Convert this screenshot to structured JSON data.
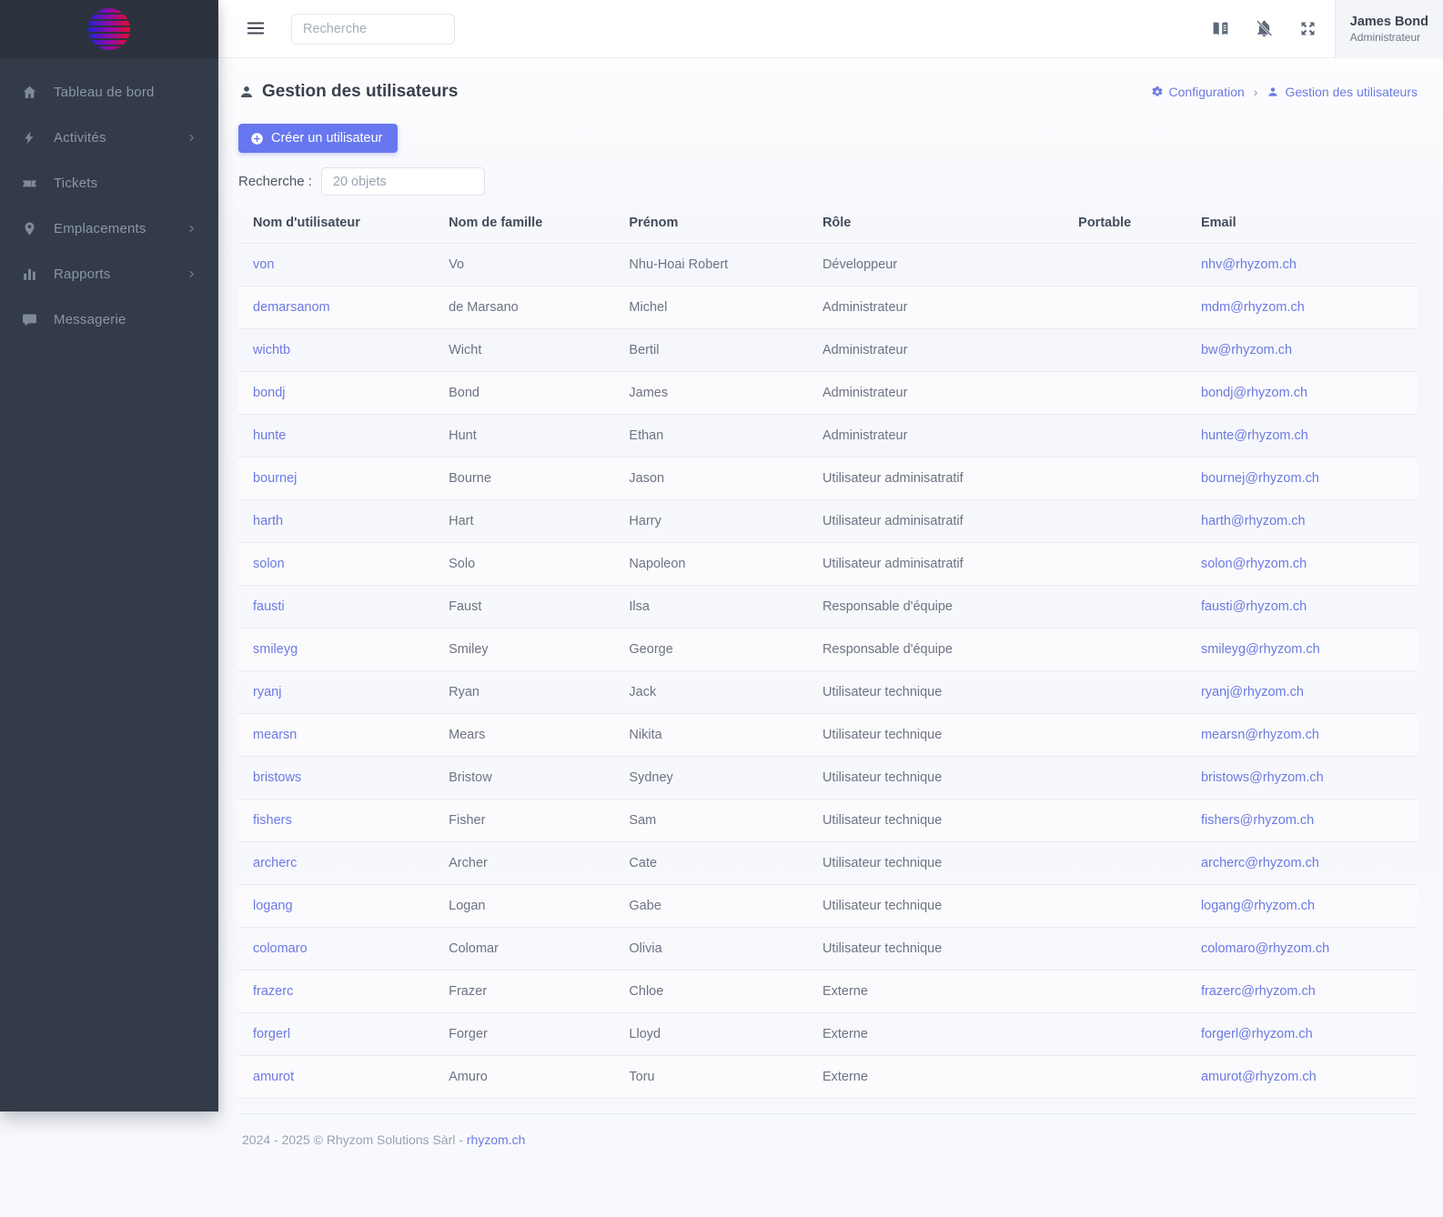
{
  "colors": {
    "accent": "#6777ef",
    "link": "#6c7ae0",
    "sidebar_bg": "#333b48"
  },
  "sidebar": {
    "items": [
      {
        "id": "dashboard",
        "icon": "home-icon",
        "label": "Tableau de bord",
        "has_submenu": false
      },
      {
        "id": "activities",
        "icon": "lightning-icon",
        "label": "Activités",
        "has_submenu": true
      },
      {
        "id": "tickets",
        "icon": "ticket-icon",
        "label": "Tickets",
        "has_submenu": false
      },
      {
        "id": "locations",
        "icon": "map-pin-icon",
        "label": "Emplacements",
        "has_submenu": true
      },
      {
        "id": "reports",
        "icon": "bar-chart-icon",
        "label": "Rapports",
        "has_submenu": true
      },
      {
        "id": "messaging",
        "icon": "chat-icon",
        "label": "Messagerie",
        "has_submenu": false
      }
    ]
  },
  "topbar": {
    "search_placeholder": "Recherche",
    "icons": [
      "book-icon",
      "bell-slash-icon",
      "fullscreen-icon"
    ],
    "user": {
      "name": "James Bond",
      "role": "Administrateur"
    }
  },
  "page": {
    "title": "Gestion des utilisateurs",
    "breadcrumb": [
      {
        "icon": "gear-icon",
        "label": "Configuration"
      },
      {
        "icon": "user-icon",
        "label": "Gestion des utilisateurs"
      }
    ],
    "breadcrumb_separator": "›",
    "create_button": "Créer un utilisateur",
    "search_label": "Recherche :",
    "search_placeholder": "20 objets"
  },
  "table": {
    "columns": [
      "Nom d'utilisateur",
      "Nom de famille",
      "Prénom",
      "Rôle",
      "Portable",
      "Email"
    ],
    "rows": [
      {
        "username": "von",
        "lastname": "Vo",
        "firstname": "Nhu-Hoai Robert",
        "role": "Développeur",
        "portable": "",
        "email": "nhv@rhyzom.ch"
      },
      {
        "username": "demarsanom",
        "lastname": "de Marsano",
        "firstname": "Michel",
        "role": "Administrateur",
        "portable": "",
        "email": "mdm@rhyzom.ch"
      },
      {
        "username": "wichtb",
        "lastname": "Wicht",
        "firstname": "Bertil",
        "role": "Administrateur",
        "portable": "",
        "email": "bw@rhyzom.ch"
      },
      {
        "username": "bondj",
        "lastname": "Bond",
        "firstname": "James",
        "role": "Administrateur",
        "portable": "",
        "email": "bondj@rhyzom.ch"
      },
      {
        "username": "hunte",
        "lastname": "Hunt",
        "firstname": "Ethan",
        "role": "Administrateur",
        "portable": "",
        "email": "hunte@rhyzom.ch"
      },
      {
        "username": "bournej",
        "lastname": "Bourne",
        "firstname": "Jason",
        "role": "Utilisateur adminisatratif",
        "portable": "",
        "email": "bournej@rhyzom.ch"
      },
      {
        "username": "harth",
        "lastname": "Hart",
        "firstname": "Harry",
        "role": "Utilisateur adminisatratif",
        "portable": "",
        "email": "harth@rhyzom.ch"
      },
      {
        "username": "solon",
        "lastname": "Solo",
        "firstname": "Napoleon",
        "role": "Utilisateur adminisatratif",
        "portable": "",
        "email": "solon@rhyzom.ch"
      },
      {
        "username": "fausti",
        "lastname": "Faust",
        "firstname": "Ilsa",
        "role": "Responsable d'équipe",
        "portable": "",
        "email": "fausti@rhyzom.ch"
      },
      {
        "username": "smileyg",
        "lastname": "Smiley",
        "firstname": "George",
        "role": "Responsable d'équipe",
        "portable": "",
        "email": "smileyg@rhyzom.ch"
      },
      {
        "username": "ryanj",
        "lastname": "Ryan",
        "firstname": "Jack",
        "role": "Utilisateur technique",
        "portable": "",
        "email": "ryanj@rhyzom.ch"
      },
      {
        "username": "mearsn",
        "lastname": "Mears",
        "firstname": "Nikita",
        "role": "Utilisateur technique",
        "portable": "",
        "email": "mearsn@rhyzom.ch"
      },
      {
        "username": "bristows",
        "lastname": "Bristow",
        "firstname": "Sydney",
        "role": "Utilisateur technique",
        "portable": "",
        "email": "bristows@rhyzom.ch"
      },
      {
        "username": "fishers",
        "lastname": "Fisher",
        "firstname": "Sam",
        "role": "Utilisateur technique",
        "portable": "",
        "email": "fishers@rhyzom.ch"
      },
      {
        "username": "archerc",
        "lastname": "Archer",
        "firstname": "Cate",
        "role": "Utilisateur technique",
        "portable": "",
        "email": "archerc@rhyzom.ch"
      },
      {
        "username": "logang",
        "lastname": "Logan",
        "firstname": "Gabe",
        "role": "Utilisateur technique",
        "portable": "",
        "email": "logang@rhyzom.ch"
      },
      {
        "username": "colomaro",
        "lastname": "Colomar",
        "firstname": "Olivia",
        "role": "Utilisateur technique",
        "portable": "",
        "email": "colomaro@rhyzom.ch"
      },
      {
        "username": "frazerc",
        "lastname": "Frazer",
        "firstname": "Chloe",
        "role": "Externe",
        "portable": "",
        "email": "frazerc@rhyzom.ch"
      },
      {
        "username": "forgerl",
        "lastname": "Forger",
        "firstname": "Lloyd",
        "role": "Externe",
        "portable": "",
        "email": "forgerl@rhyzom.ch"
      },
      {
        "username": "amurot",
        "lastname": "Amuro",
        "firstname": "Toru",
        "role": "Externe",
        "portable": "",
        "email": "amurot@rhyzom.ch"
      }
    ]
  },
  "footer": {
    "copyright": "2024 - 2025 © Rhyzom Solutions Sàrl - ",
    "link": "rhyzom.ch"
  }
}
